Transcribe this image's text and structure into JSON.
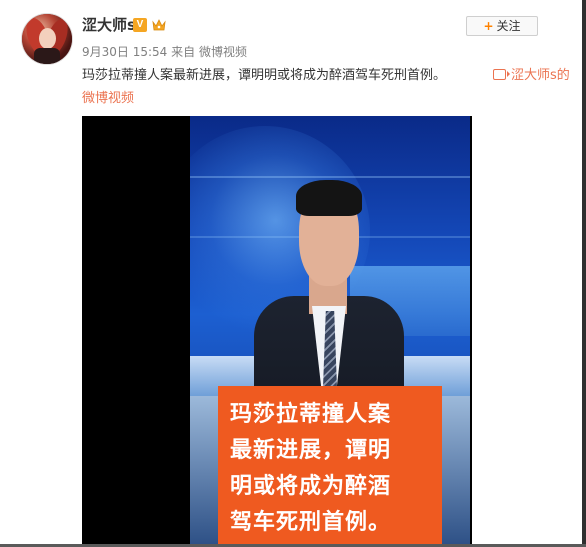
{
  "user": {
    "name": "涩大师s",
    "verified_badge": "V",
    "crown_color": "#f5a623"
  },
  "follow_button": {
    "label": "关注",
    "plus_symbol": "+"
  },
  "meta": {
    "date": "9月30日 15:54",
    "source_prefix": "来自",
    "source": "微博视频"
  },
  "post": {
    "text": "玛莎拉蒂撞人案最新进展，谭明明或将成为醉酒驾车死刑首例。",
    "video_link_label": "涩大师s的",
    "video_link_label_2": "微博视频",
    "link_color": "#eb7350"
  },
  "video": {
    "caption_lines": [
      "玛莎拉蒂撞人案",
      "最新进展，谭明",
      "明或将成为醉酒",
      "驾车死刑首例。"
    ],
    "caption_color": "#ef5a20"
  }
}
